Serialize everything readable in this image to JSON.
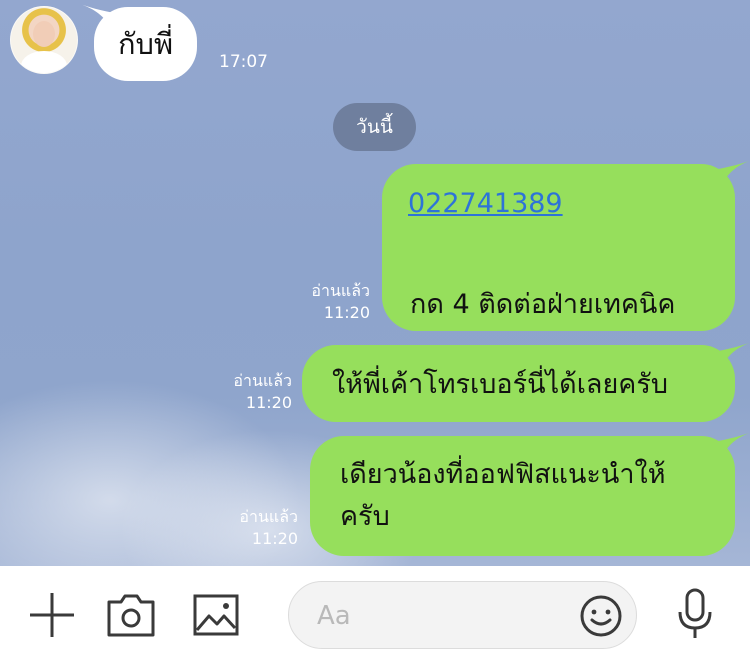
{
  "conversation": {
    "incoming": {
      "text": "กับพี่",
      "time": "17:07"
    },
    "date_divider": "วันนี้",
    "outgoing": [
      {
        "link": "022741389",
        "text": "กด 4 ติดต่อฝ่ายเทคนิค",
        "status": "อ่านแล้ว",
        "time": "11:20"
      },
      {
        "text": "ให้พี่เค้าโทรเบอร์นี่ได้เลยครับ",
        "status": "อ่านแล้ว",
        "time": "11:20"
      },
      {
        "text_line1": "เดียวน้องที่ออฟฟิสแนะนำให้",
        "text_line2": "ครับ",
        "status": "อ่านแล้ว",
        "time": "11:20"
      }
    ]
  },
  "composer": {
    "placeholder": "Aa",
    "icons": [
      "plus-icon",
      "camera-icon",
      "image-icon",
      "emoji-icon",
      "microphone-icon"
    ]
  },
  "colors": {
    "outgoing_bubble": "#96df5c",
    "incoming_bubble": "#ffffff",
    "link": "#2d73d8",
    "chat_background": "#8fa5cc"
  }
}
